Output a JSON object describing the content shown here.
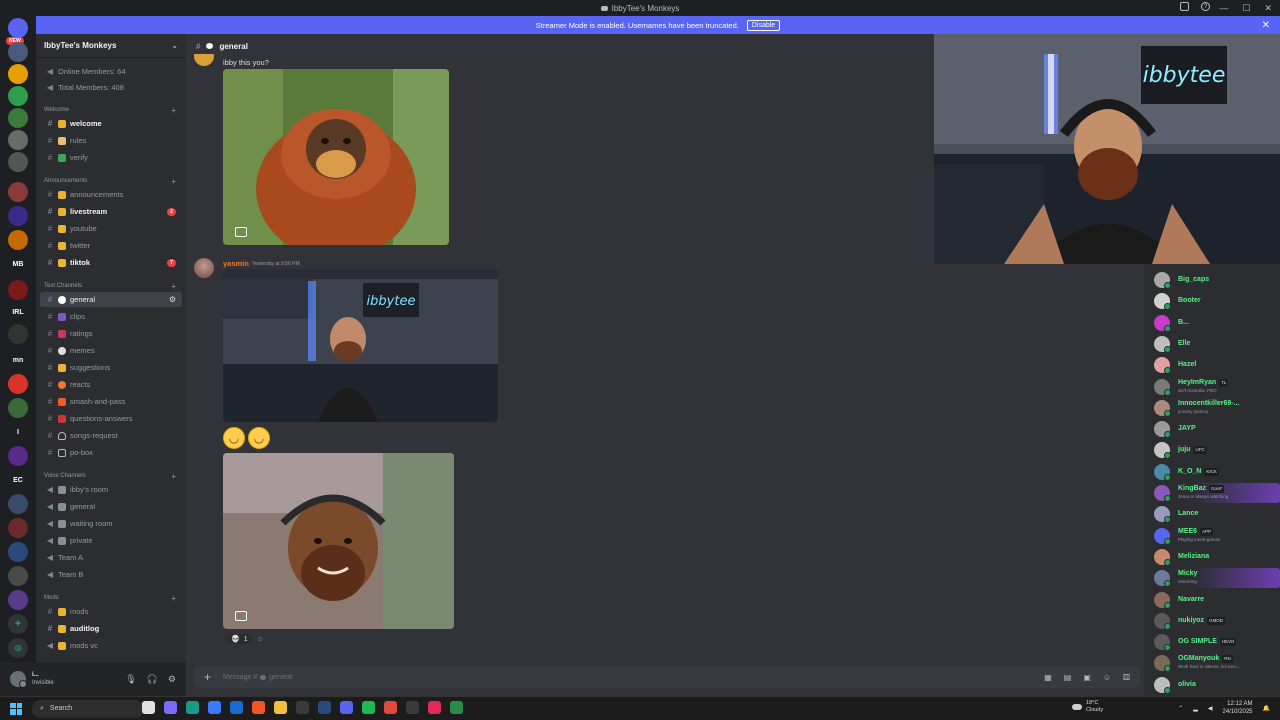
{
  "window": {
    "title": "IbbyTee's Monkeys"
  },
  "banner": {
    "text": "Streamer Mode is enabled. Usernames have been truncated.",
    "disable_label": "Disable",
    "color": "#5865f2"
  },
  "rail": {
    "new_label": "NEW",
    "labels": {
      "mb": "MB",
      "irl": "IRL",
      "mn": "mn",
      "i": "I",
      "ec": "EC"
    }
  },
  "sidebar": {
    "server_name": "IbbyTee's Monkeys",
    "stats": [
      "Online Members: 64",
      "Total Members: 408"
    ],
    "categories": {
      "welcome": "Welcome",
      "announcements": "Announcements",
      "text": "Text Channels",
      "voice": "Voice Channels",
      "mods": "Mods"
    },
    "channels": {
      "welcome": "welcome",
      "rules": "rules",
      "verify": "verify",
      "announcements": "announcements",
      "livestream": "livestream",
      "livestream_badge": "2",
      "youtube": "youtube",
      "twitter": "twitter",
      "tiktok": "tiktok",
      "tiktok_badge": "7",
      "general": "general",
      "clips": "clips",
      "ratings": "ratings",
      "memes": "memes",
      "suggestions": "suggestions",
      "reacts": "reacts",
      "smash": "smash-and-pass",
      "qa": "questions-answers",
      "songs": "songs-request",
      "pobox": "po-box",
      "ibbys_room": "ibby's room",
      "v_general": "general",
      "waiting": "waiting room",
      "private": "private",
      "team_a": "Team A",
      "team_b": "Team B",
      "mods": "mods",
      "auditlog": "auditlog",
      "modsvc": "mods vc"
    }
  },
  "user_panel": {
    "name": "i...",
    "status": "Invisible"
  },
  "chat": {
    "channel": "general",
    "msg1_text": "ibby this you?",
    "msg2_author": "yasmin",
    "msg2_time": "Yesterday at 9:56 PM",
    "reaction_count": "1",
    "composer_placeholder": "Message #",
    "composer_channel": "general",
    "author_color": "#e67e22"
  },
  "members": [
    {
      "name": "Big_caps",
      "tag": "",
      "status": ""
    },
    {
      "name": "Booter",
      "tag": "",
      "status": ""
    },
    {
      "name": "B...",
      "tag": "",
      "status": ""
    },
    {
      "name": "Elle",
      "tag": "",
      "status": ""
    },
    {
      "name": "Hazel",
      "tag": "",
      "status": ""
    },
    {
      "name": "HeyImRyan",
      "tag": "TL",
      "status": "ain't Australia. PBO"
    },
    {
      "name": "Innocentkiller69-...",
      "tag": "",
      "status": "yummy yummy"
    },
    {
      "name": "JAYP",
      "tag": "",
      "status": ""
    },
    {
      "name": "juju",
      "tag": "UFC",
      "status": ""
    },
    {
      "name": "K_O_N",
      "tag": "KICK",
      "status": ""
    },
    {
      "name": "KingBaz",
      "tag": "GooF",
      "status": "Jesus is always watching"
    },
    {
      "name": "Lance",
      "tag": "",
      "status": ""
    },
    {
      "name": "MEE6",
      "tag": "APP",
      "status": "Playing mee6-games"
    },
    {
      "name": "Meliziana",
      "tag": "",
      "status": ""
    },
    {
      "name": "Micky",
      "tag": "",
      "status": "restarting"
    },
    {
      "name": "Navarre",
      "tag": "",
      "status": ""
    },
    {
      "name": "nukiyoz",
      "tag": "GMOD",
      "status": ""
    },
    {
      "name": "OG SIMPLE",
      "tag": "HEVN",
      "status": ""
    },
    {
      "name": "OGManyouk",
      "tag": "RN",
      "status": "Work hard in silence, let succ..."
    },
    {
      "name": "olivia",
      "tag": "",
      "status": ""
    }
  ],
  "taskbar": {
    "search": "Search",
    "weather_temp": "18°C",
    "weather_desc": "Cloudy",
    "time": "12:12 AM",
    "date": "24/10/2025"
  }
}
